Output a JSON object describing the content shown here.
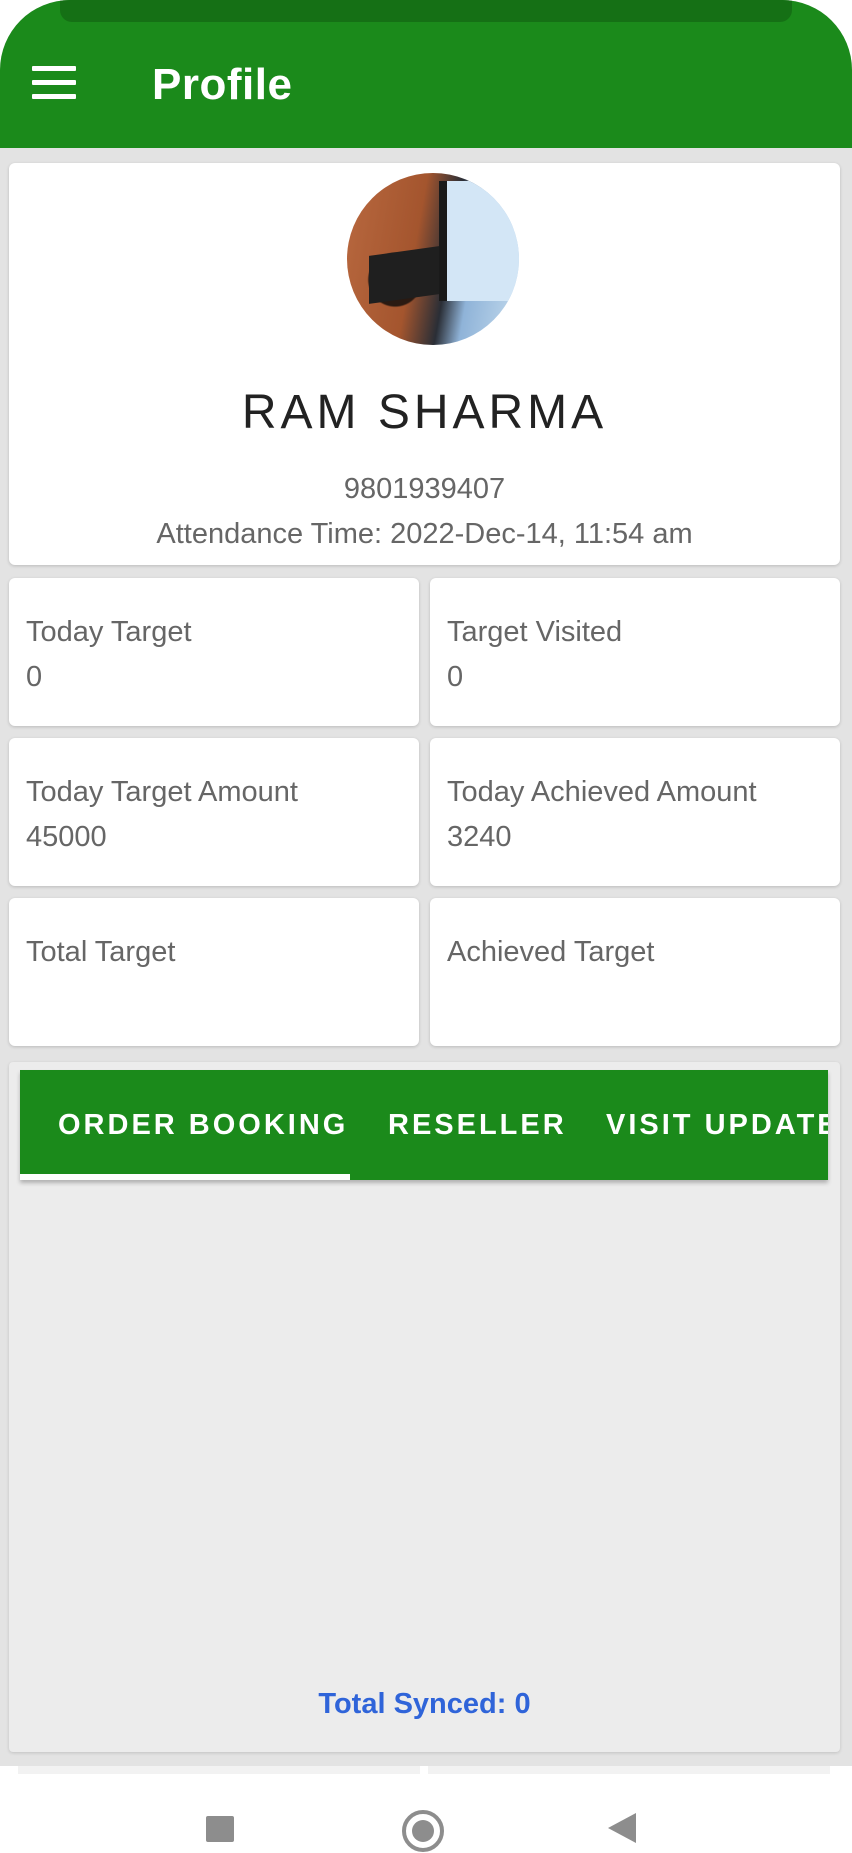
{
  "app_bar": {
    "title": "Profile",
    "menu_icon": "hamburger-menu-icon",
    "color": "#1b8a1b"
  },
  "profile": {
    "name": "RAM SHARMA",
    "phone": "9801939407",
    "attendance": "Attendance Time: 2022-Dec-14, 11:54 am"
  },
  "stats": [
    {
      "label": "Today Target",
      "value": "0"
    },
    {
      "label": "Target Visited",
      "value": "0"
    },
    {
      "label": "Today Target Amount",
      "value": "45000"
    },
    {
      "label": "Today Achieved Amount",
      "value": "3240"
    },
    {
      "label": "Total Target",
      "value": ""
    },
    {
      "label": "Achieved Target",
      "value": ""
    }
  ],
  "tabs": [
    {
      "label": "ORDER BOOKING",
      "selected": true
    },
    {
      "label": "RESELLER",
      "selected": false
    },
    {
      "label": "VISIT UPDATE",
      "selected": false
    }
  ],
  "footer": {
    "synced": "Total Synced: 0",
    "synced_color": "#2f64d9"
  },
  "nav_bar": {
    "icons": [
      "recents-square-icon",
      "home-circle-icon",
      "back-triangle-icon"
    ]
  }
}
